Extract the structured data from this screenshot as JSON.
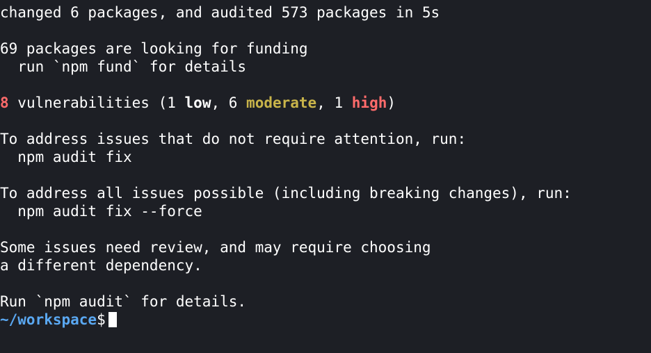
{
  "terminal": {
    "lines": {
      "changed": "changed 6 packages, and audited 573 packages in 5s",
      "funding": "69 packages are looking for funding",
      "fund_cmd": "  run `npm fund` for details",
      "vuln_count": "8",
      "vuln_text_a": " vulnerabilities (1 ",
      "vuln_low": "low",
      "vuln_text_b": ", 6 ",
      "vuln_moderate": "moderate",
      "vuln_text_c": ", 1 ",
      "vuln_high": "high",
      "vuln_text_d": ")",
      "address_no_attention": "To address issues that do not require attention, run:",
      "audit_fix": "  npm audit fix",
      "address_all": "To address all issues possible (including breaking changes), run:",
      "audit_fix_force": "  npm audit fix --force",
      "review_a": "Some issues need review, and may require choosing",
      "review_b": "a different dependency.",
      "run_audit": "Run `npm audit` for details."
    },
    "prompt": {
      "path": "~/workspace",
      "symbol": "$"
    },
    "colors": {
      "background": "#1d1f25",
      "text": "#ffffff",
      "count": "#ff6b6b",
      "moderate": "#c9b44a",
      "high": "#ff6b6b",
      "prompt_path": "#5aa8f2"
    }
  }
}
